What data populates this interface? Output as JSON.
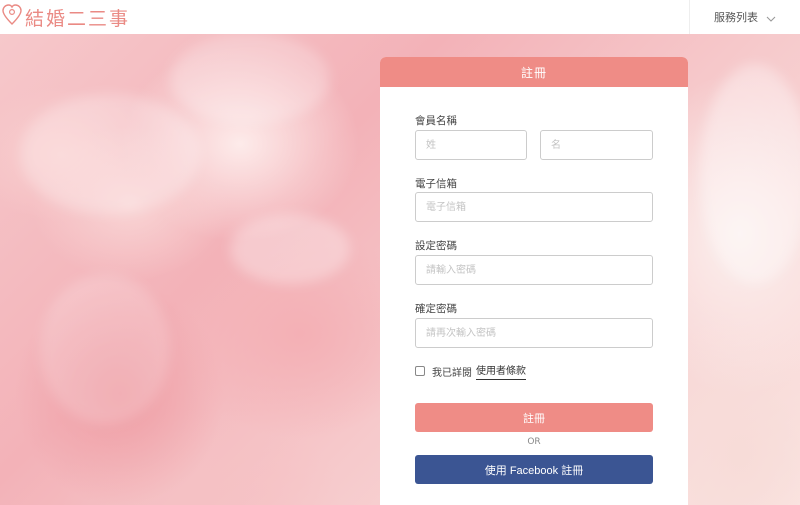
{
  "header": {
    "logo_text": "結婚二三事",
    "service_menu_label": "服務列表"
  },
  "form": {
    "title": "註冊",
    "member_name_label": "會員名稱",
    "last_name_placeholder": "姓",
    "first_name_placeholder": "名",
    "email_label": "電子信箱",
    "email_placeholder": "電子信箱",
    "password_label": "設定密碼",
    "password_placeholder": "請輸入密碼",
    "confirm_label": "確定密碼",
    "confirm_placeholder": "請再次輸入密碼",
    "agree_text": "我已詳閱",
    "terms_link": "使用者條款",
    "register_button": "註冊",
    "or_text": "OR",
    "facebook_button": "使用 Facebook 註冊"
  },
  "colors": {
    "accent": "#ef8c86",
    "facebook": "#3b5593"
  }
}
